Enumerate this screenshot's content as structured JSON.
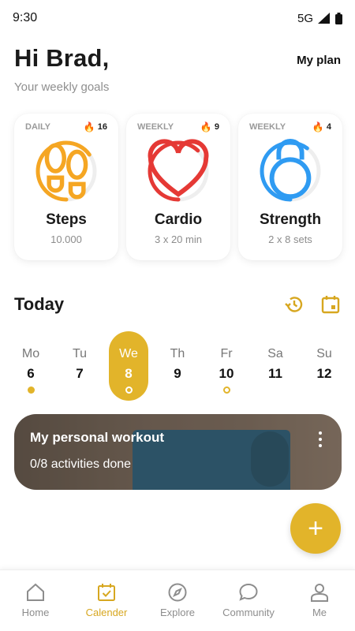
{
  "status": {
    "time": "9:30",
    "network": "5G"
  },
  "header": {
    "greeting": "Hi Brad,",
    "subtitle": "Your weekly goals",
    "my_plan": "My plan"
  },
  "colors": {
    "accent": "#e2b42a",
    "steps": "#f5a623",
    "cardio": "#e53935",
    "strength": "#2f9bf2"
  },
  "goals": [
    {
      "period": "DAILY",
      "streak": "16",
      "title": "Steps",
      "detail": "10.000",
      "icon": "footprints-icon",
      "progress": 0.65
    },
    {
      "period": "WEEKLY",
      "streak": "9",
      "title": "Cardio",
      "detail": "3 x 20 min",
      "icon": "heart-icon",
      "progress": 0.62
    },
    {
      "period": "WEEKLY",
      "streak": "4",
      "title": "Strength",
      "detail": "2 x 8 sets",
      "icon": "kettlebell-icon",
      "progress": 0.6
    }
  ],
  "today": {
    "title": "Today"
  },
  "week": [
    {
      "name": "Mo",
      "num": "6",
      "marker": "filled"
    },
    {
      "name": "Tu",
      "num": "7",
      "marker": "none"
    },
    {
      "name": "We",
      "num": "8",
      "marker": "ring",
      "active": true
    },
    {
      "name": "Th",
      "num": "9",
      "marker": "none"
    },
    {
      "name": "Fr",
      "num": "10",
      "marker": "ring"
    },
    {
      "name": "Sa",
      "num": "11",
      "marker": "none"
    },
    {
      "name": "Su",
      "num": "12",
      "marker": "none"
    }
  ],
  "workout": {
    "title": "My personal workout",
    "progress_text": "0/8 activities done"
  },
  "fab": {
    "label": "+"
  },
  "nav": [
    {
      "label": "Home",
      "icon": "home-icon"
    },
    {
      "label": "Calender",
      "icon": "calendar-check-icon",
      "active": true
    },
    {
      "label": "Explore",
      "icon": "compass-icon"
    },
    {
      "label": "Community",
      "icon": "chat-bubble-icon"
    },
    {
      "label": "Me",
      "icon": "person-icon"
    }
  ]
}
